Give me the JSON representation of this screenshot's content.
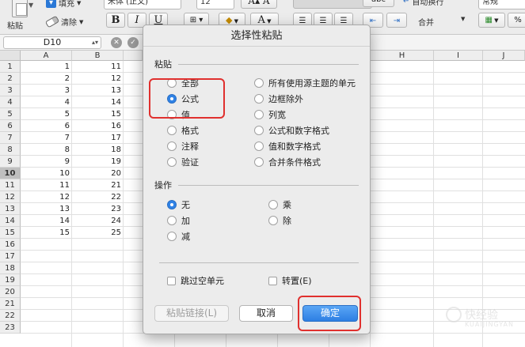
{
  "ribbon": {
    "paste_label": "粘贴",
    "fill_label": "填充",
    "clear_label": "清除",
    "font_name": "宋体 (正文)",
    "font_size": "12",
    "bold": "B",
    "italic": "I",
    "underline": "U",
    "font_grow": "A",
    "font_shrink": "A",
    "font_color": "A",
    "wrap_label": "自动换行",
    "merge_label": "合并",
    "number_format": "常规",
    "abc_label": "abc"
  },
  "formula_bar": {
    "name_box": "D10"
  },
  "grid": {
    "columns": [
      "A",
      "B",
      "H",
      "I",
      "J"
    ],
    "rows": [
      "1",
      "2",
      "3",
      "4",
      "5",
      "6",
      "7",
      "8",
      "9",
      "10",
      "11",
      "12",
      "13",
      "14",
      "15",
      "16",
      "17",
      "18",
      "19",
      "20",
      "21",
      "22",
      "23"
    ],
    "selected_row": "10",
    "col_a": [
      "1",
      "2",
      "3",
      "4",
      "5",
      "6",
      "7",
      "8",
      "9",
      "10",
      "11",
      "12",
      "13",
      "14",
      "15"
    ],
    "col_b": [
      "11",
      "12",
      "13",
      "14",
      "15",
      "16",
      "17",
      "18",
      "19",
      "20",
      "21",
      "22",
      "23",
      "24",
      "25"
    ]
  },
  "dialog": {
    "title": "选择性粘贴",
    "paste_section": "粘贴",
    "paste_options_left": [
      "全部",
      "公式",
      "值",
      "格式",
      "注释",
      "验证"
    ],
    "paste_options_right": [
      "所有使用源主题的单元",
      "边框除外",
      "列宽",
      "公式和数字格式",
      "值和数字格式",
      "合并条件格式"
    ],
    "paste_selected": "公式",
    "operation_section": "操作",
    "operation_left": [
      "无",
      "加",
      "减"
    ],
    "operation_right": [
      "乘",
      "除"
    ],
    "operation_selected": "无",
    "skip_blanks": "跳过空单元",
    "transpose": "转置(E)",
    "paste_link": "粘贴链接(L)",
    "cancel": "取消",
    "ok": "确定"
  },
  "colors": {
    "accent_blue": "#2f82e6",
    "highlight_red": "#e0302e"
  },
  "watermark": {
    "text": "快经验",
    "sub": "KUAIJINGYAN"
  }
}
